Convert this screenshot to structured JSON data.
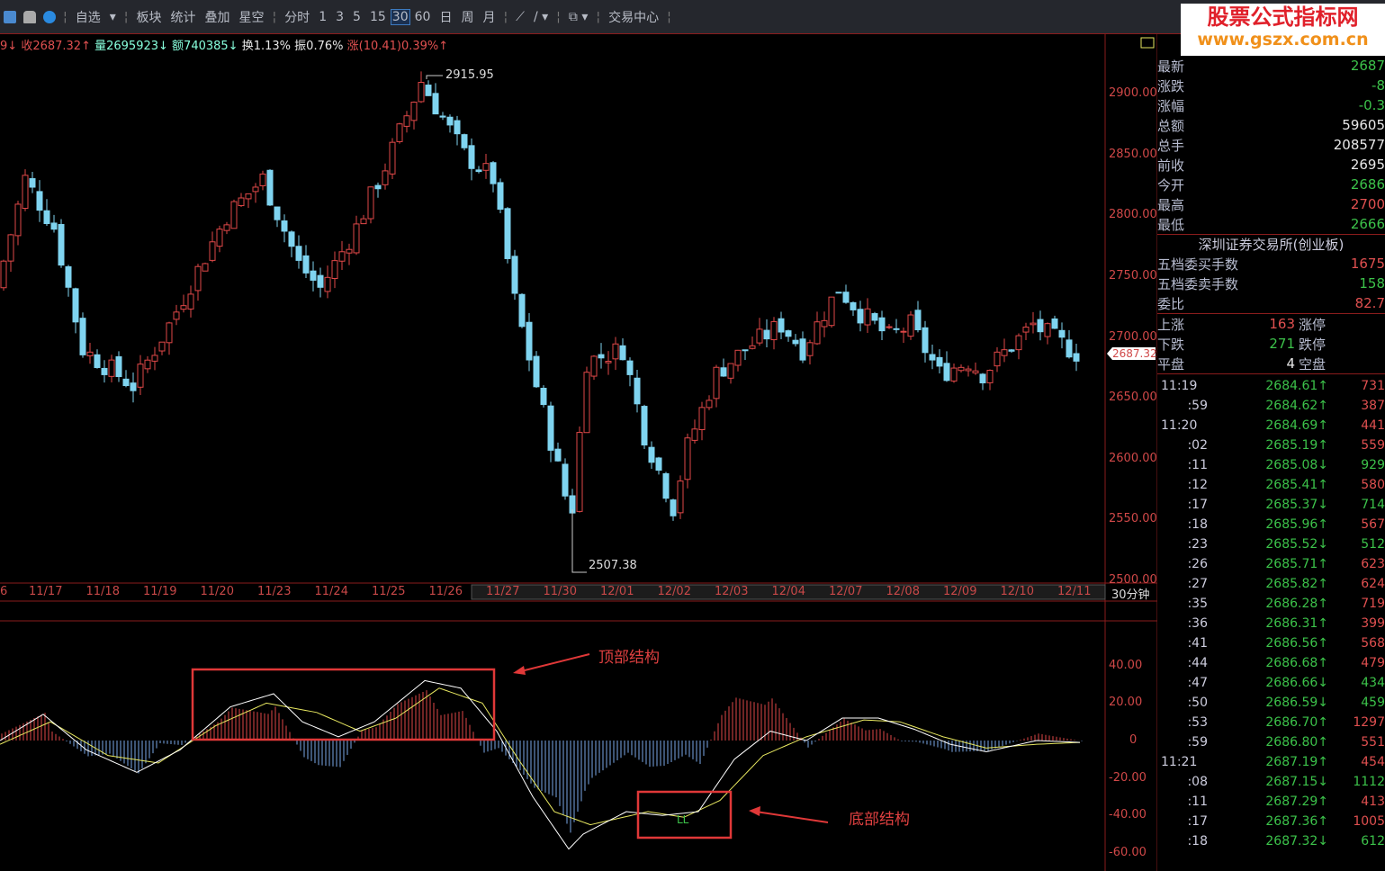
{
  "toolbar": {
    "items": [
      "自选",
      "板块",
      "统计",
      "叠加",
      "星空",
      "分时",
      "1",
      "3",
      "5",
      "15",
      "30",
      "60",
      "日",
      "周",
      "月",
      "交易中心"
    ],
    "selected_period": "30"
  },
  "info": {
    "prefix": "9↓",
    "close": "收2687.32↑",
    "volume": "量2695923↓",
    "amount": "额740385↓",
    "turnover": "换1.13%",
    "amplitude": "振0.76%",
    "change": "涨(10.41)0.39%↑"
  },
  "logo": {
    "title": "股票公式指标网",
    "url": "www.gszx.com.cn"
  },
  "colors": {
    "up": "#e04848",
    "down": "#7fd4f0",
    "dif": "#ffffff",
    "dea": "#e8e860",
    "box": "#e03838"
  },
  "chart": {
    "period_label": "30分钟",
    "high_label": "2915.95",
    "low_label": "2507.38",
    "last_price": "2687.32",
    "price_ticks": [
      "2900.00",
      "2850.00",
      "2800.00",
      "2750.00",
      "2700.00",
      "2650.00",
      "2600.00",
      "2550.00",
      "2500.00"
    ],
    "dates": [
      "6",
      "11/17",
      "11/18",
      "11/19",
      "11/20",
      "11/23",
      "11/24",
      "11/25",
      "11/26",
      "11/27",
      "11/30",
      "12/01",
      "12/02",
      "12/03",
      "12/04",
      "12/07",
      "12/08",
      "12/09",
      "12/10",
      "12/11"
    ],
    "price_path": [
      [
        0,
        2740
      ],
      [
        4,
        2830
      ],
      [
        8,
        2790
      ],
      [
        12,
        2690
      ],
      [
        19,
        2660
      ],
      [
        24,
        2710
      ],
      [
        32,
        2800
      ],
      [
        37,
        2830
      ],
      [
        42,
        2760
      ],
      [
        45,
        2740
      ],
      [
        50,
        2790
      ],
      [
        54,
        2840
      ],
      [
        59,
        2910
      ],
      [
        62,
        2880
      ],
      [
        65,
        2850
      ],
      [
        69,
        2830
      ],
      [
        72,
        2730
      ],
      [
        75,
        2660
      ],
      [
        79,
        2570
      ],
      [
        80,
        2560
      ],
      [
        82,
        2680
      ],
      [
        87,
        2690
      ],
      [
        90,
        2620
      ],
      [
        94,
        2560
      ],
      [
        96,
        2610
      ],
      [
        100,
        2670
      ],
      [
        104,
        2690
      ],
      [
        109,
        2710
      ],
      [
        112,
        2690
      ],
      [
        117,
        2740
      ],
      [
        120,
        2720
      ],
      [
        124,
        2700
      ],
      [
        127,
        2710
      ],
      [
        131,
        2670
      ],
      [
        135,
        2680
      ],
      [
        137,
        2670
      ],
      [
        144,
        2710
      ],
      [
        150,
        2687
      ]
    ],
    "macd_ticks": [
      "40.00",
      "20.00",
      "0",
      "-20.00",
      "-40.00",
      "-60.00"
    ],
    "dif_path": [
      [
        0,
        0
      ],
      [
        6,
        14
      ],
      [
        12,
        -5
      ],
      [
        19,
        -17
      ],
      [
        25,
        -5
      ],
      [
        32,
        18
      ],
      [
        38,
        25
      ],
      [
        42,
        10
      ],
      [
        47,
        2
      ],
      [
        52,
        10
      ],
      [
        59,
        32
      ],
      [
        64,
        28
      ],
      [
        69,
        5
      ],
      [
        74,
        -30
      ],
      [
        79,
        -58
      ],
      [
        81,
        -50
      ],
      [
        87,
        -38
      ],
      [
        92,
        -40
      ],
      [
        97,
        -38
      ],
      [
        102,
        -10
      ],
      [
        107,
        5
      ],
      [
        112,
        0
      ],
      [
        117,
        12
      ],
      [
        122,
        12
      ],
      [
        127,
        6
      ],
      [
        132,
        -2
      ],
      [
        137,
        -6
      ],
      [
        144,
        0
      ],
      [
        150,
        -1
      ]
    ],
    "dea_path": [
      [
        0,
        -2
      ],
      [
        7,
        10
      ],
      [
        15,
        -8
      ],
      [
        22,
        -12
      ],
      [
        30,
        8
      ],
      [
        37,
        20
      ],
      [
        44,
        15
      ],
      [
        50,
        5
      ],
      [
        55,
        12
      ],
      [
        61,
        28
      ],
      [
        67,
        20
      ],
      [
        72,
        -10
      ],
      [
        77,
        -38
      ],
      [
        82,
        -45
      ],
      [
        90,
        -38
      ],
      [
        95,
        -41
      ],
      [
        100,
        -32
      ],
      [
        106,
        -8
      ],
      [
        112,
        2
      ],
      [
        120,
        11
      ],
      [
        125,
        10
      ],
      [
        131,
        2
      ],
      [
        137,
        -4
      ],
      [
        144,
        -2
      ],
      [
        150,
        -1
      ]
    ],
    "bottom_marker": "LL"
  },
  "annotations": {
    "top": "顶部结构",
    "bottom": "底部结构"
  },
  "quote": {
    "rows": [
      {
        "label": "最新",
        "value": "2687",
        "c": "grn"
      },
      {
        "label": "涨跌",
        "value": "-8",
        "c": "grn"
      },
      {
        "label": "涨幅",
        "value": "-0.3",
        "c": "grn"
      },
      {
        "label": "总额",
        "value": "59605",
        "c": "wht"
      },
      {
        "label": "总手",
        "value": "208577",
        "c": "wht"
      },
      {
        "label": "前收",
        "value": "2695",
        "c": "wht"
      },
      {
        "label": "今开",
        "value": "2686",
        "c": "grn"
      },
      {
        "label": "最高",
        "value": "2700",
        "c": "red"
      },
      {
        "label": "最低",
        "value": "2666",
        "c": "grn"
      }
    ],
    "exchange": "深圳证券交易所(创业板)",
    "orders": [
      {
        "label": "五档委买手数",
        "value": "1675",
        "c": "red"
      },
      {
        "label": "五档委卖手数",
        "value": "158",
        "c": "grn"
      },
      {
        "label": "委比",
        "value": "82.7",
        "c": "red"
      }
    ],
    "breadth": [
      {
        "label": "上涨",
        "num": "163",
        "c": "red",
        "tag": "涨停"
      },
      {
        "label": "下跌",
        "num": "271",
        "c": "grn",
        "tag": "跌停"
      },
      {
        "label": "平盘",
        "num": "4",
        "c": "wht",
        "tag": "空盘"
      }
    ]
  },
  "ticks": [
    {
      "t": "11:19",
      "p": "2684.61↑",
      "q": "731",
      "c": "red",
      "full": true
    },
    {
      "t": ":59",
      "p": "2684.62↑",
      "q": "387",
      "c": "red"
    },
    {
      "t": "11:20",
      "p": "2684.69↑",
      "q": "441",
      "c": "red",
      "full": true
    },
    {
      "t": ":02",
      "p": "2685.19↑",
      "q": "559",
      "c": "red"
    },
    {
      "t": ":11",
      "p": "2685.08↓",
      "q": "929",
      "c": "grn"
    },
    {
      "t": ":12",
      "p": "2685.41↑",
      "q": "580",
      "c": "red"
    },
    {
      "t": ":17",
      "p": "2685.37↓",
      "q": "714",
      "c": "grn"
    },
    {
      "t": ":18",
      "p": "2685.96↑",
      "q": "567",
      "c": "red"
    },
    {
      "t": ":23",
      "p": "2685.52↓",
      "q": "512",
      "c": "grn"
    },
    {
      "t": ":26",
      "p": "2685.71↑",
      "q": "623",
      "c": "red"
    },
    {
      "t": ":27",
      "p": "2685.82↑",
      "q": "624",
      "c": "red"
    },
    {
      "t": ":35",
      "p": "2686.28↑",
      "q": "719",
      "c": "red"
    },
    {
      "t": ":36",
      "p": "2686.31↑",
      "q": "399",
      "c": "red"
    },
    {
      "t": ":41",
      "p": "2686.56↑",
      "q": "568",
      "c": "red"
    },
    {
      "t": ":44",
      "p": "2686.68↑",
      "q": "479",
      "c": "red"
    },
    {
      "t": ":47",
      "p": "2686.66↓",
      "q": "434",
      "c": "grn"
    },
    {
      "t": ":50",
      "p": "2686.59↓",
      "q": "459",
      "c": "grn"
    },
    {
      "t": ":53",
      "p": "2686.70↑",
      "q": "1297",
      "c": "red"
    },
    {
      "t": ":59",
      "p": "2686.80↑",
      "q": "551",
      "c": "red"
    },
    {
      "t": "11:21",
      "p": "2687.19↑",
      "q": "454",
      "c": "red",
      "full": true
    },
    {
      "t": ":08",
      "p": "2687.15↓",
      "q": "1112",
      "c": "grn"
    },
    {
      "t": ":11",
      "p": "2687.29↑",
      "q": "413",
      "c": "red"
    },
    {
      "t": ":17",
      "p": "2687.36↑",
      "q": "1005",
      "c": "red"
    },
    {
      "t": ":18",
      "p": "2687.32↓",
      "q": "612",
      "c": "grn"
    }
  ]
}
